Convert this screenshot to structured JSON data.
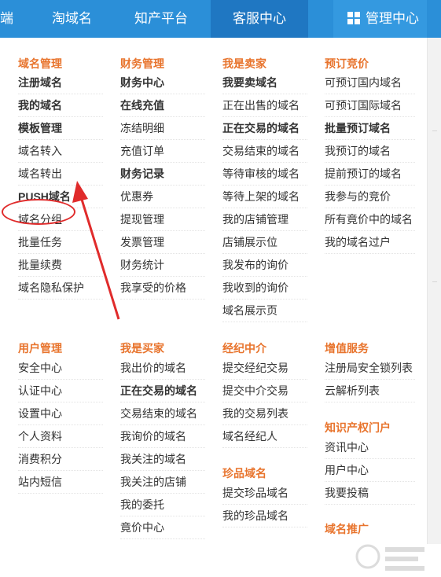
{
  "nav": {
    "items": [
      {
        "label": "端"
      },
      {
        "label": "淘域名"
      },
      {
        "label": "知产平台"
      },
      {
        "label": "客服中心"
      },
      {
        "label": "管理中心"
      }
    ],
    "icon": "grid-icon",
    "active_index": 3
  },
  "columns": [
    {
      "sections": [
        {
          "title": "域名管理",
          "items": [
            {
              "label": "注册域名",
              "bold": true
            },
            {
              "label": "我的域名",
              "bold": true
            },
            {
              "label": "模板管理",
              "bold": true
            },
            {
              "label": "域名转入",
              "bold": false
            },
            {
              "label": "域名转出",
              "bold": false
            },
            {
              "label": "PUSH域名",
              "bold": true
            },
            {
              "label": "域名分组",
              "bold": false
            },
            {
              "label": "批量任务",
              "bold": false
            },
            {
              "label": "批量续费",
              "bold": false
            },
            {
              "label": "域名隐私保护",
              "bold": false
            }
          ]
        },
        {
          "title": "用户管理",
          "items": [
            {
              "label": "安全中心",
              "bold": false
            },
            {
              "label": "认证中心",
              "bold": false
            },
            {
              "label": "设置中心",
              "bold": false
            },
            {
              "label": "个人资料",
              "bold": false
            },
            {
              "label": "消费积分",
              "bold": false
            },
            {
              "label": "站内短信",
              "bold": false
            }
          ]
        }
      ]
    },
    {
      "sections": [
        {
          "title": "财务管理",
          "items": [
            {
              "label": "财务中心",
              "bold": true
            },
            {
              "label": "在线充值",
              "bold": true
            },
            {
              "label": "冻结明细",
              "bold": false
            },
            {
              "label": "充值订单",
              "bold": false
            },
            {
              "label": "财务记录",
              "bold": true
            },
            {
              "label": "优惠券",
              "bold": false
            },
            {
              "label": "提现管理",
              "bold": false
            },
            {
              "label": "发票管理",
              "bold": false
            },
            {
              "label": "财务统计",
              "bold": false
            },
            {
              "label": "我享受的价格",
              "bold": false
            }
          ]
        },
        {
          "title": "我是买家",
          "items": [
            {
              "label": "我出价的域名",
              "bold": false
            },
            {
              "label": "正在交易的域名",
              "bold": true
            },
            {
              "label": "交易结束的域名",
              "bold": false
            },
            {
              "label": "我询价的域名",
              "bold": false
            },
            {
              "label": "我关注的域名",
              "bold": false
            },
            {
              "label": "我关注的店铺",
              "bold": false
            },
            {
              "label": "我的委托",
              "bold": false
            },
            {
              "label": "竟价中心",
              "bold": false
            }
          ]
        }
      ]
    },
    {
      "sections": [
        {
          "title": "我是卖家",
          "items": [
            {
              "label": "我要卖域名",
              "bold": true
            },
            {
              "label": "正在出售的域名",
              "bold": false
            },
            {
              "label": "正在交易的域名",
              "bold": true
            },
            {
              "label": "交易结束的域名",
              "bold": false
            },
            {
              "label": "等待审核的域名",
              "bold": false
            },
            {
              "label": "等待上架的域名",
              "bold": false
            },
            {
              "label": "我的店铺管理",
              "bold": false
            },
            {
              "label": "店铺展示位",
              "bold": false
            },
            {
              "label": "我发布的询价",
              "bold": false
            },
            {
              "label": "我收到的询价",
              "bold": false
            },
            {
              "label": "域名展示页",
              "bold": false
            }
          ]
        },
        {
          "title": "经纪中介",
          "items": [
            {
              "label": "提交经纪交易",
              "bold": false
            },
            {
              "label": "提交中介交易",
              "bold": false
            },
            {
              "label": "我的交易列表",
              "bold": false
            },
            {
              "label": "域名经纪人",
              "bold": false
            }
          ]
        },
        {
          "title": "珍品域名",
          "items": [
            {
              "label": "提交珍品域名",
              "bold": false
            },
            {
              "label": "我的珍品域名",
              "bold": false
            }
          ]
        }
      ]
    },
    {
      "sections": [
        {
          "title": "预订竞价",
          "items": [
            {
              "label": "可预订国内域名",
              "bold": false
            },
            {
              "label": "可预订国际域名",
              "bold": false
            },
            {
              "label": "批量预订域名",
              "bold": true
            },
            {
              "label": "我预订的域名",
              "bold": false
            },
            {
              "label": "提前预订的域名",
              "bold": false
            },
            {
              "label": "我参与的竞价",
              "bold": false
            },
            {
              "label": "所有竟价中的域名",
              "bold": false
            },
            {
              "label": "我的域名过户",
              "bold": false
            }
          ]
        },
        {
          "title": "增值服务",
          "items": [
            {
              "label": "注册局安全锁列表",
              "bold": false
            },
            {
              "label": "云解析列表",
              "bold": false
            }
          ]
        },
        {
          "title": "知识产权门户",
          "items": [
            {
              "label": "资讯中心",
              "bold": false
            },
            {
              "label": "用户中心",
              "bold": false
            },
            {
              "label": "我要投稿",
              "bold": false
            }
          ]
        },
        {
          "title": "域名推广",
          "items": []
        }
      ]
    }
  ],
  "annotation": {
    "highlight_color": "#e02b2b"
  },
  "colors": {
    "nav_bg": "#2b8fd8",
    "nav_active": "#1f77c2",
    "heading": "#e8742d",
    "link": "#333333"
  }
}
